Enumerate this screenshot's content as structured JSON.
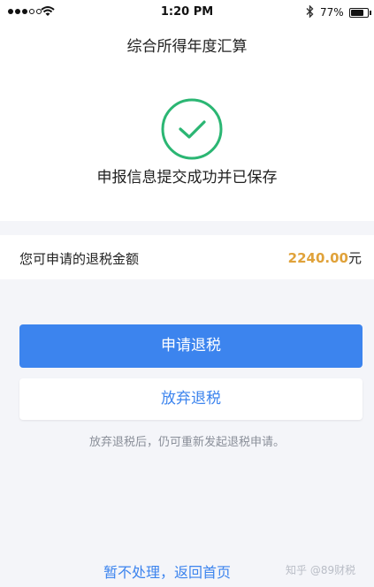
{
  "status_bar": {
    "time": "1:20 PM",
    "battery_percent": "77%",
    "battery_level": 0.77,
    "signal_bars_filled": 3,
    "signal_bars_total": 5
  },
  "header": {
    "title": "综合所得年度汇算"
  },
  "result": {
    "icon": "check-circle-icon",
    "message": "申报信息提交成功并已保存",
    "accent_color": "#2bb673"
  },
  "refund": {
    "label": "您可申请的退税金额",
    "amount": "2240.00",
    "unit": "元",
    "amount_color": "#e0a23a"
  },
  "actions": {
    "apply_label": "申请退税",
    "abandon_label": "放弃退税",
    "hint": "放弃退税后，仍可重新发起退税申请。",
    "later_link": "暂不处理，返回首页",
    "primary_color": "#3c84ee"
  },
  "watermark": "知乎 @89财税"
}
